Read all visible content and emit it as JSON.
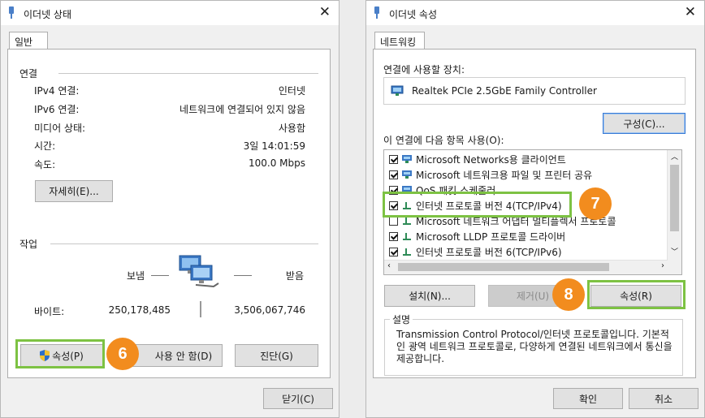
{
  "left_window": {
    "title": "이더넷 상태",
    "close_label": "✕",
    "tab": "일반",
    "connection": {
      "section": "연결",
      "rows": [
        {
          "label": "IPv4 연결:",
          "value": "인터넷"
        },
        {
          "label": "IPv6 연결:",
          "value": "네트워크에 연결되어 있지 않음"
        },
        {
          "label": "미디어 상태:",
          "value": "사용함"
        },
        {
          "label": "시간:",
          "value": "3일 14:01:59"
        },
        {
          "label": "속도:",
          "value": "100.0 Mbps"
        }
      ],
      "details_button": "자세히(E)..."
    },
    "activity": {
      "section": "작업",
      "sent_label": "보냄",
      "received_label": "받음",
      "bytes_label": "바이트:",
      "bytes_sent": "250,178,485",
      "bytes_received": "3,506,067,746"
    },
    "buttons": {
      "properties": "속성(P)",
      "disable": "사용 안 함(D)",
      "diagnose": "진단(G)",
      "close": "닫기(C)"
    }
  },
  "right_window": {
    "title": "이더넷 속성",
    "close_label": "✕",
    "tab": "네트워킹",
    "connect_using_label": "연결에 사용할 장치:",
    "adapter_name": "Realtek PCIe 2.5GbE Family Controller",
    "configure_button": "구성(C)...",
    "items_label": "이 연결에 다음 항목 사용(O):",
    "items": [
      {
        "label": "Microsoft Networks용 클라이언트",
        "checked": true,
        "icon": "network-client-icon"
      },
      {
        "label": "Microsoft 네트워크용 파일 및 프린터 공유",
        "checked": true,
        "icon": "network-client-icon"
      },
      {
        "label": "QoS 패킷 스케줄러",
        "checked": true,
        "icon": "network-client-icon"
      },
      {
        "label": "인터넷 프로토콜 버전 4(TCP/IPv4)",
        "checked": true,
        "icon": "protocol-icon"
      },
      {
        "label": "Microsoft 네트워크 어댑터 멀티플렉서 프로토콜",
        "checked": false,
        "icon": "protocol-icon"
      },
      {
        "label": "Microsoft LLDP 프로토콜 드라이버",
        "checked": true,
        "icon": "protocol-icon"
      },
      {
        "label": "인터넷 프로토콜 버전 6(TCP/IPv6)",
        "checked": true,
        "icon": "protocol-icon"
      }
    ],
    "buttons": {
      "install": "설치(N)...",
      "uninstall": "제거(U)",
      "properties": "속성(R)",
      "ok": "확인",
      "cancel": "취소"
    },
    "description": {
      "legend": "설명",
      "text": "Transmission Control Protocol/인터넷 프로토콜입니다. 기본적인 광역 네트워크 프로토콜로, 다양하게 연결된 네트워크에서 통신을 제공합니다."
    }
  },
  "annotations": {
    "step6": "6",
    "step7": "7",
    "step8": "8"
  },
  "colors": {
    "highlight": "#7dc243",
    "badge": "#f28c1e"
  }
}
